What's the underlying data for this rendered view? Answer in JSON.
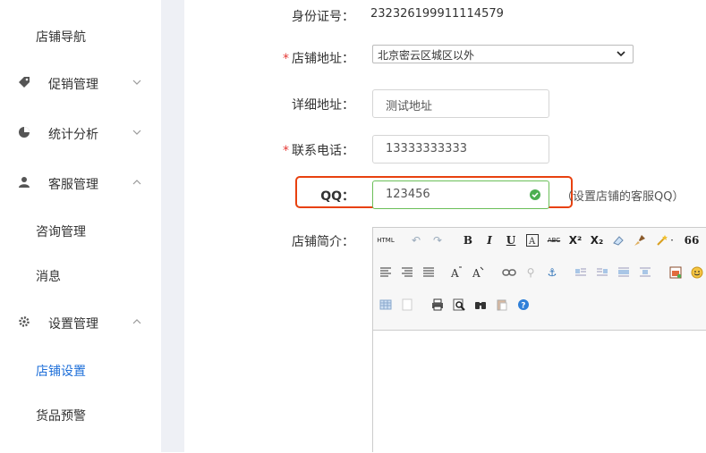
{
  "sidebar": {
    "items": [
      {
        "label": "店铺导航"
      },
      {
        "label": "促销管理"
      },
      {
        "label": "统计分析"
      },
      {
        "label": "客服管理"
      },
      {
        "label": "咨询管理"
      },
      {
        "label": "消息"
      },
      {
        "label": "设置管理"
      },
      {
        "label": "店铺设置"
      },
      {
        "label": "货品预警"
      }
    ]
  },
  "form": {
    "id_label": "身份证号：",
    "id_value": "232326199911114579",
    "address_label": "店铺地址：",
    "address_selected": "北京密云区城区以外",
    "detail_label": "详细地址：",
    "detail_value": "测试地址",
    "phone_label": "联系电话：",
    "phone_value": "13333333333",
    "qq_label": "QQ：",
    "qq_value": "123456",
    "qq_hint": "（设置店铺的客服QQ）",
    "intro_label": "店铺简介："
  },
  "editor": {
    "html_label": "HTML",
    "bold": "B",
    "italic": "I",
    "underline": "U",
    "strike": "ABC",
    "quote": "66"
  },
  "colors": {
    "accent": "#1e6fd9",
    "required": "#e53935",
    "highlight": "#e8410f",
    "valid": "#4caf50"
  }
}
